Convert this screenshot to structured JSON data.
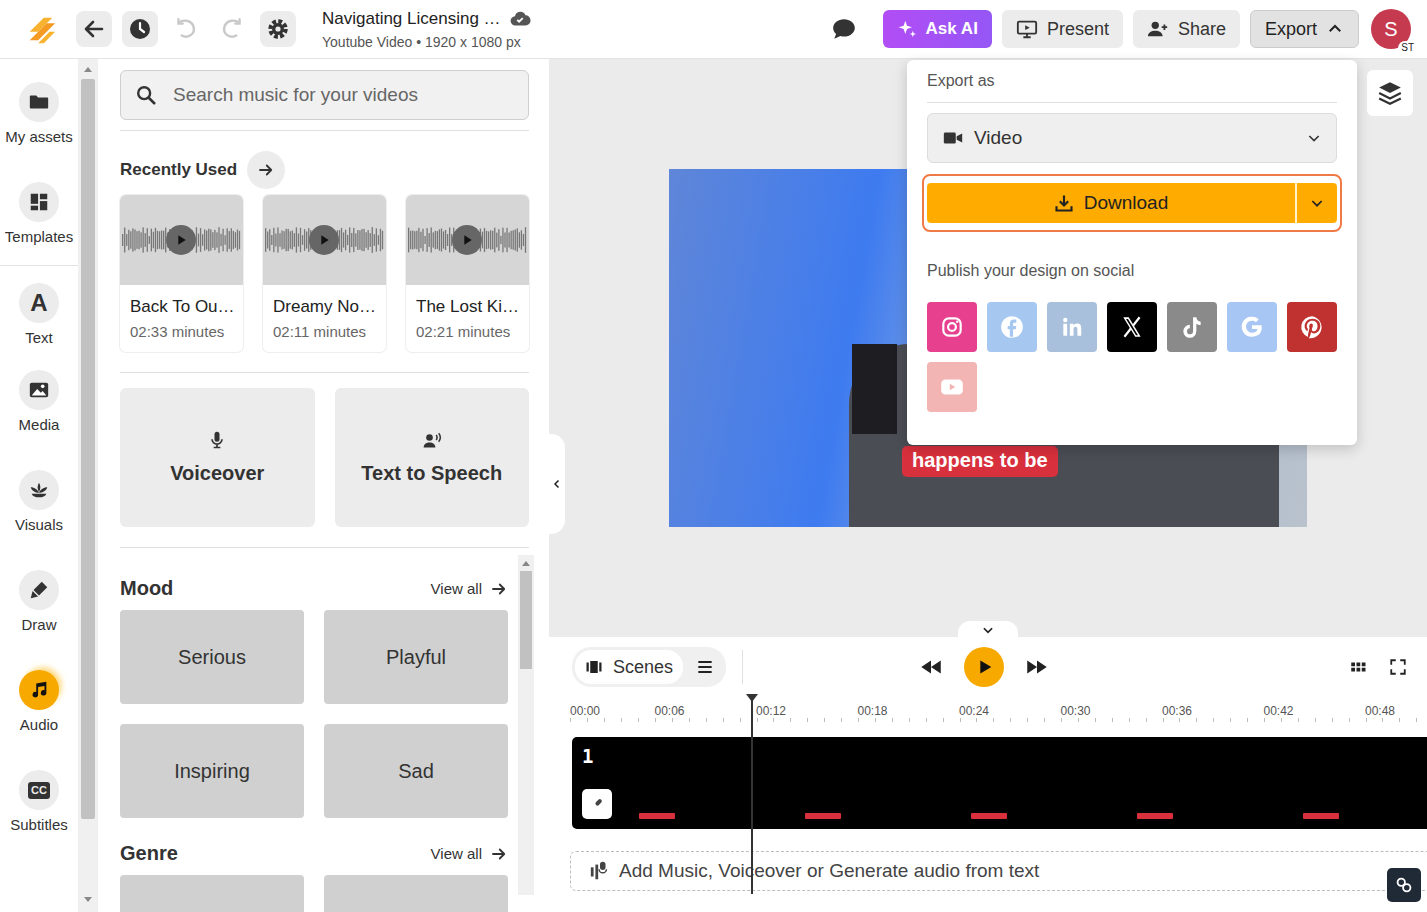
{
  "header": {
    "title": "Navigating Licensing …",
    "subtitle": "Youtube Video • 1920 x 1080 px",
    "undo_disabled": true,
    "redo_disabled": true,
    "ask_ai": "Ask AI",
    "present": "Present",
    "share": "Share",
    "export": {
      "label": "Export",
      "expanded": true
    },
    "avatar": {
      "initial": "S",
      "badge": "ST"
    }
  },
  "rail": [
    {
      "label": "My assets",
      "selected": false
    },
    {
      "label": "Templates",
      "selected": false
    },
    {
      "label": "Text",
      "selected": false,
      "icon_text": "A"
    },
    {
      "label": "Media",
      "selected": false
    },
    {
      "label": "Visuals",
      "selected": false
    },
    {
      "label": "Draw",
      "selected": false
    },
    {
      "label": "Audio",
      "selected": true
    },
    {
      "label": "Subtitles",
      "selected": false,
      "icon_text": "CC"
    }
  ],
  "panel": {
    "search_placeholder": "Search music for your videos",
    "recent": {
      "title": "Recently Used",
      "tracks": [
        {
          "title": "Back To Ou…",
          "duration": "02:33 minutes"
        },
        {
          "title": "Dreamy No…",
          "duration": "02:11 minutes"
        },
        {
          "title": "The Lost Ki…",
          "duration": "02:21 minutes"
        }
      ]
    },
    "tools": [
      "Voiceover",
      "Text to Speech"
    ],
    "mood": {
      "title": "Mood",
      "view_all": "View all",
      "items": [
        "Serious",
        "Playful",
        "Inspiring",
        "Sad"
      ]
    },
    "genre": {
      "title": "Genre",
      "view_all": "View all"
    }
  },
  "canvas": {
    "subtitle": "happens to be"
  },
  "timeline": {
    "scenes_label": "Scenes",
    "ruler": [
      "00:00",
      "00:06",
      "00:12",
      "00:18",
      "00:24",
      "00:30",
      "00:36",
      "00:42",
      "00:48"
    ],
    "scenes": [
      {
        "number": "1"
      }
    ],
    "audio_prompt": "Add Music, Voiceover or Generate audio from text"
  },
  "export_menu": {
    "label": "Export as",
    "format": "Video",
    "download": "Download",
    "publish_label": "Publish your design on social",
    "social": [
      {
        "kind": "instagram",
        "color": "#e6408f"
      },
      {
        "kind": "facebook",
        "color": "#a6c8f0"
      },
      {
        "kind": "linkedin",
        "color": "#a9c0dc"
      },
      {
        "kind": "x",
        "color": "#000000"
      },
      {
        "kind": "tiktok",
        "color": "#8a8a8a"
      },
      {
        "kind": "google",
        "color": "#a7c6f3"
      },
      {
        "kind": "pinterest",
        "color": "#c0322f"
      },
      {
        "kind": "youtube",
        "color": "#f3b4b4"
      }
    ]
  }
}
